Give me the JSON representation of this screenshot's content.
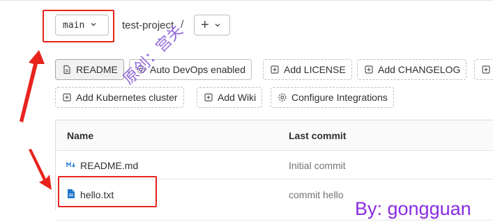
{
  "repo_header": {
    "branch": "main",
    "project_name": "test-project",
    "separator": "/",
    "add_button_label": "+"
  },
  "quick_actions": {
    "row1": [
      {
        "label": "README",
        "icon": "file-icon"
      },
      {
        "label": "Auto DevOps enabled",
        "icon": "settings-icon"
      },
      {
        "label": "Add LICENSE",
        "icon": "plus-square-icon"
      },
      {
        "label": "Add CHANGELOG",
        "icon": "plus-square-icon"
      }
    ],
    "row2": [
      {
        "label": "Add Kubernetes cluster",
        "icon": "plus-square-icon"
      },
      {
        "label": "Add Wiki",
        "icon": "plus-square-icon"
      },
      {
        "label": "Configure Integrations",
        "icon": "settings-icon"
      }
    ]
  },
  "file_table": {
    "columns": [
      "Name",
      "Last commit"
    ],
    "rows": [
      {
        "name": "README.md",
        "icon": "markdown-icon",
        "last_commit": "Initial commit"
      },
      {
        "name": "hello.txt",
        "icon": "text-file-icon",
        "last_commit": "commit hello"
      }
    ]
  },
  "overlays": {
    "watermark": "原创：宫关",
    "byline": "By: gongguan",
    "annotation_color": "#e8231e",
    "byline_color": "#8a2be2"
  }
}
